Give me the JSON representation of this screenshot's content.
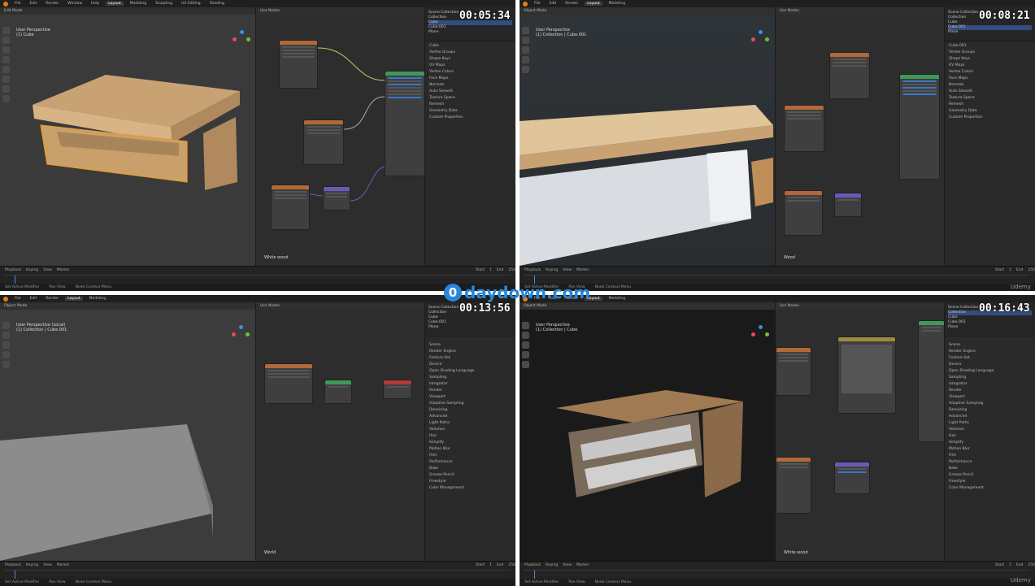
{
  "panes": [
    {
      "timestamp": "00:05:34",
      "mode": "Edit Mode",
      "view_label": "User Perspective",
      "object_label": "(1) Cube",
      "material": "White wood",
      "outliner": [
        "Scene Collection",
        "Collection",
        "Cube",
        "Cube.001",
        "Plane"
      ],
      "panel": [
        "Cube",
        "Vertex Groups",
        "Shape Keys",
        "UV Maps",
        "Vertex Colors",
        "Face Maps",
        "Normals",
        "Auto Smooth",
        "Texture Space",
        "Remesh",
        "Geometry Data",
        "Custom Properties"
      ]
    },
    {
      "timestamp": "00:08:21",
      "mode": "Object Mode",
      "view_label": "User Perspective",
      "object_label": "(1) Collection | Cube.001",
      "material": "Wood",
      "outliner": [
        "Scene Collection",
        "Collection",
        "Cube",
        "Cube.001",
        "Plane"
      ],
      "panel": [
        "Cube.001",
        "Vertex Groups",
        "Shape Keys",
        "UV Maps",
        "Vertex Colors",
        "Face Maps",
        "Normals",
        "Auto Smooth",
        "Texture Space",
        "Remesh",
        "Geometry Data",
        "Custom Properties"
      ]
    },
    {
      "timestamp": "00:13:56",
      "mode": "Object Mode",
      "view_label": "User Perspective (Local)",
      "object_label": "(1) Collection | Cube.001",
      "material": "World",
      "outliner": [
        "Scene Collection",
        "Collection",
        "Cube",
        "Cube.001",
        "Plane"
      ],
      "panel": [
        "Scene",
        "Render Engine",
        "Feature Set",
        "Device",
        "Open Shading Language",
        "Sampling",
        "Integrator",
        "Render",
        "Viewport",
        "Adaptive Sampling",
        "Denoising",
        "Advanced",
        "Light Paths",
        "Volumes",
        "Hair",
        "Simplify",
        "Motion Blur",
        "Film",
        "Performance",
        "Bake",
        "Grease Pencil",
        "Freestyle",
        "Color Management"
      ]
    },
    {
      "timestamp": "00:16:43",
      "mode": "Object Mode",
      "view_label": "User Perspective",
      "object_label": "(1) Collection | Cube",
      "material": "White wood",
      "outliner": [
        "Scene Collection",
        "Collection",
        "Cube",
        "Cube.001",
        "Plane"
      ],
      "panel": [
        "Scene",
        "Render Engine",
        "Feature Set",
        "Device",
        "Open Shading Language",
        "Sampling",
        "Integrator",
        "Render",
        "Viewport",
        "Adaptive Sampling",
        "Denoising",
        "Advanced",
        "Light Paths",
        "Volumes",
        "Hair",
        "Simplify",
        "Motion Blur",
        "Film",
        "Performance",
        "Bake",
        "Grease Pencil",
        "Freestyle",
        "Color Management"
      ]
    }
  ],
  "menus": [
    "File",
    "Edit",
    "Render",
    "Window",
    "Help"
  ],
  "workspaces": [
    "Layout",
    "Modeling",
    "Sculpting",
    "UV Editing",
    "Texture Paint",
    "Shading",
    "Animation",
    "Rendering",
    "Compositing",
    "Geometry Nodes",
    "Scripting"
  ],
  "timeline": {
    "playback": "Playback",
    "keying": "Keying",
    "view": "View",
    "marker": "Marker",
    "frame": "1",
    "start_label": "Start",
    "start": "1",
    "end_label": "End",
    "end": "250"
  },
  "status": [
    "Set Active Modifier",
    "Pan View",
    "Node Context Menu"
  ],
  "watermark": {
    "badge": "0",
    "text": "daydown.com"
  },
  "udemy": "Udemy",
  "colors": {
    "accent": "#e87d0d",
    "selection": "#334d80",
    "watermark": "#2a86d8"
  }
}
